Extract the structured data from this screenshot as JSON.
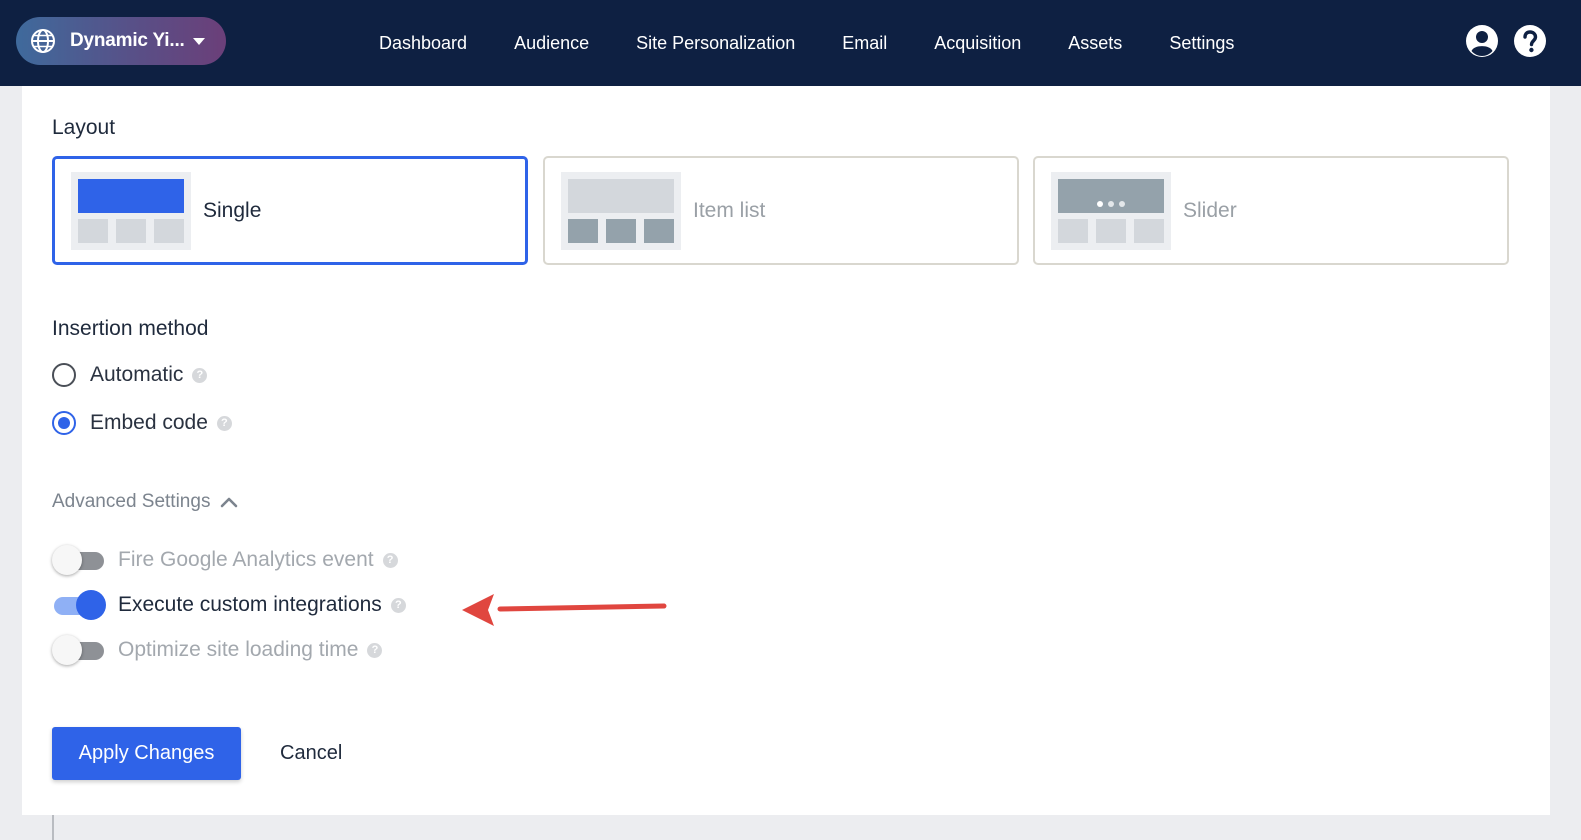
{
  "header": {
    "site_name": "Dynamic Yi...",
    "nav": [
      "Dashboard",
      "Audience",
      "Site Personalization",
      "Email",
      "Acquisition",
      "Assets",
      "Settings"
    ],
    "icons": [
      "user-circle-icon",
      "help-circle-icon"
    ]
  },
  "layout": {
    "title": "Layout",
    "options": [
      {
        "label": "Single",
        "selected": true
      },
      {
        "label": "Item list",
        "selected": false
      },
      {
        "label": "Slider",
        "selected": false
      }
    ]
  },
  "insertion": {
    "title": "Insertion method",
    "options": [
      {
        "label": "Automatic",
        "checked": false
      },
      {
        "label": "Embed code",
        "checked": true
      }
    ]
  },
  "advanced": {
    "title": "Advanced Settings",
    "expanded": true,
    "toggles": [
      {
        "label": "Fire Google Analytics event",
        "on": false
      },
      {
        "label": "Execute custom integrations",
        "on": true
      },
      {
        "label": "Optimize site loading time",
        "on": false
      }
    ]
  },
  "actions": {
    "apply": "Apply Changes",
    "cancel": "Cancel"
  },
  "colors": {
    "nav_bg": "#0e2042",
    "primary": "#2f63e8",
    "annotation_arrow": "#e0463f"
  }
}
